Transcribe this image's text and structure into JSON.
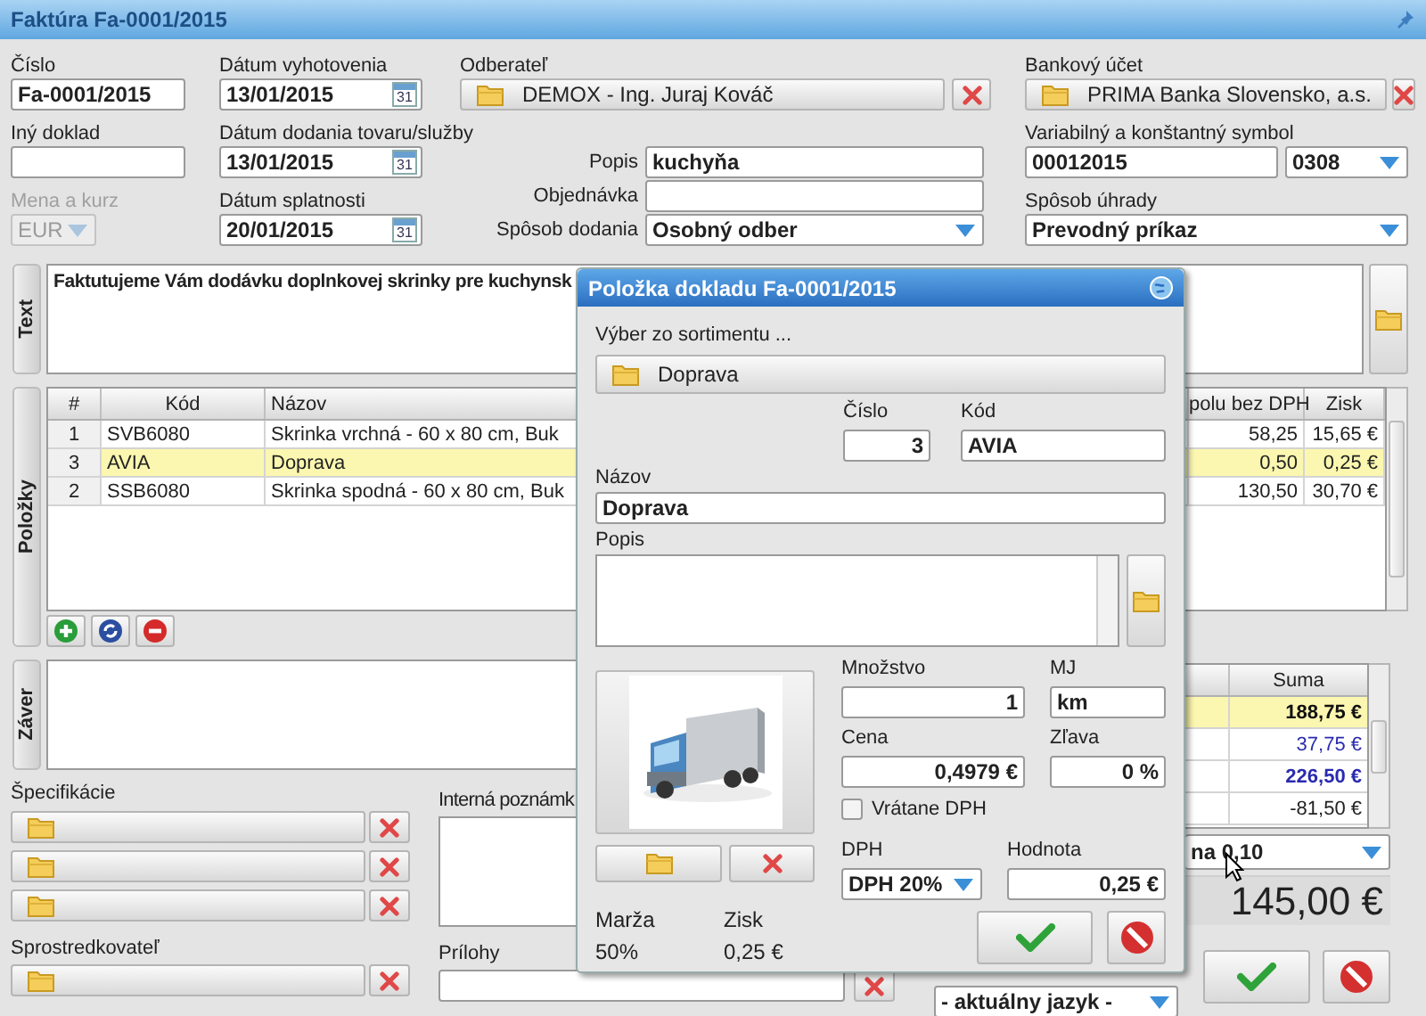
{
  "window": {
    "title": "Faktúra Fa-0001/2015"
  },
  "header": {
    "cislo": {
      "label": "Číslo",
      "value": "Fa-0001/2015"
    },
    "iny_doklad": {
      "label": "Iný doklad"
    },
    "mena": {
      "label": "Mena a kurz",
      "value": "EUR",
      "disabled": true
    },
    "dates": [
      {
        "label": "Dátum vyhotovenia",
        "value": "13/01/2015",
        "calendar_day": "31"
      },
      {
        "label": "Dátum dodania tovaru/služby",
        "value": "13/01/2015",
        "calendar_day": "31"
      },
      {
        "label": "Dátum splatnosti",
        "value": "20/01/2015",
        "calendar_day": "31"
      }
    ],
    "odberatel": {
      "label": "Odberateľ",
      "value": "DEMOX - Ing. Juraj Kováč"
    },
    "popis": {
      "label": "Popis",
      "value": "kuchyňa"
    },
    "objednavka": {
      "label": "Objednávka"
    },
    "sposob_dodania": {
      "label": "Spôsob dodania",
      "value": "Osobný odber"
    },
    "bankovy_ucet": {
      "label": "Bankový účet",
      "value": "PRIMA Banka Slovensko, a.s."
    },
    "symbol": {
      "label": "Variabilný a konštantný symbol",
      "variable": "00012015",
      "constant": "0308"
    },
    "sposob_uhrady": {
      "label": "Spôsob úhrady",
      "value": "Prevodný príkaz"
    }
  },
  "text_section": {
    "tab": "Text",
    "value": "Faktutujeme Vám dodávku doplnkovej skrinky pre kuchynsk"
  },
  "items": {
    "tab": "Položky",
    "columns": [
      "#",
      "Kód",
      "Názov",
      "polu bez DPH",
      "Zisk"
    ],
    "rows": [
      {
        "cells": [
          "1",
          "SVB6080",
          "Skrinka vrchná - 60 x 80 cm, Buk",
          "58,25",
          "15,65 €"
        ],
        "selected": false
      },
      {
        "cells": [
          "3",
          "AVIA",
          "Doprava",
          "0,50",
          "0,25 €"
        ],
        "selected": true
      },
      {
        "cells": [
          "2",
          "SSB6080",
          "Skrinka spodná - 60 x 80 cm, Buk",
          "130,50",
          "30,70 €"
        ],
        "selected": false
      }
    ]
  },
  "zaver": {
    "tab": "Záver"
  },
  "totals": {
    "column": "Suma",
    "rows": [
      {
        "kind": "subtotal",
        "value": "188,75 €",
        "selected": true
      },
      {
        "kind": "tax",
        "value": "37,75 €",
        "selected": false
      },
      {
        "kind": "total",
        "value": "226,50 €",
        "selected": false
      },
      {
        "kind": "plain",
        "value": "-81,50 €",
        "selected": false
      }
    ]
  },
  "rounding": {
    "value": "na 0,10"
  },
  "grand_total": "145,00 €",
  "specifikacie": {
    "label": "Špecifikácie",
    "slots": [
      {
        "kind": "file"
      },
      {
        "kind": "file"
      },
      {
        "kind": "file"
      }
    ]
  },
  "sprostredkovatel": {
    "label": "Sprostredkovateľ"
  },
  "interna_poznamka": {
    "label": "Interná poznámk"
  },
  "prilohy": {
    "label": "Prílohy"
  },
  "language": {
    "value": "- aktuálny jazyk -"
  },
  "dialog": {
    "title": "Položka dokladu Fa-0001/2015",
    "picker": {
      "label": "Výber zo sortimentu ...",
      "value": "Doprava"
    },
    "cislo": {
      "label": "Číslo",
      "value": "3"
    },
    "kod": {
      "label": "Kód",
      "value": "AVIA"
    },
    "nazov": {
      "label": "Názov",
      "value": "Doprava"
    },
    "popis": {
      "label": "Popis"
    },
    "mnozstvo": {
      "label": "Množstvo",
      "value": "1"
    },
    "mj": {
      "label": "MJ",
      "value": "km"
    },
    "cena": {
      "label": "Cena",
      "value": "0,4979 €"
    },
    "zlava": {
      "label": "Zľava",
      "value": "0 %"
    },
    "vratane_dph": {
      "label": "Vrátane DPH",
      "checked": false
    },
    "dph": {
      "label": "DPH",
      "value": "DPH 20%"
    },
    "hodnota": {
      "label": "Hodnota",
      "value": "0,25 €"
    },
    "marza": {
      "label": "Marža",
      "value": "50%"
    },
    "zisk": {
      "label": "Zisk",
      "value": "0,25 €"
    }
  }
}
